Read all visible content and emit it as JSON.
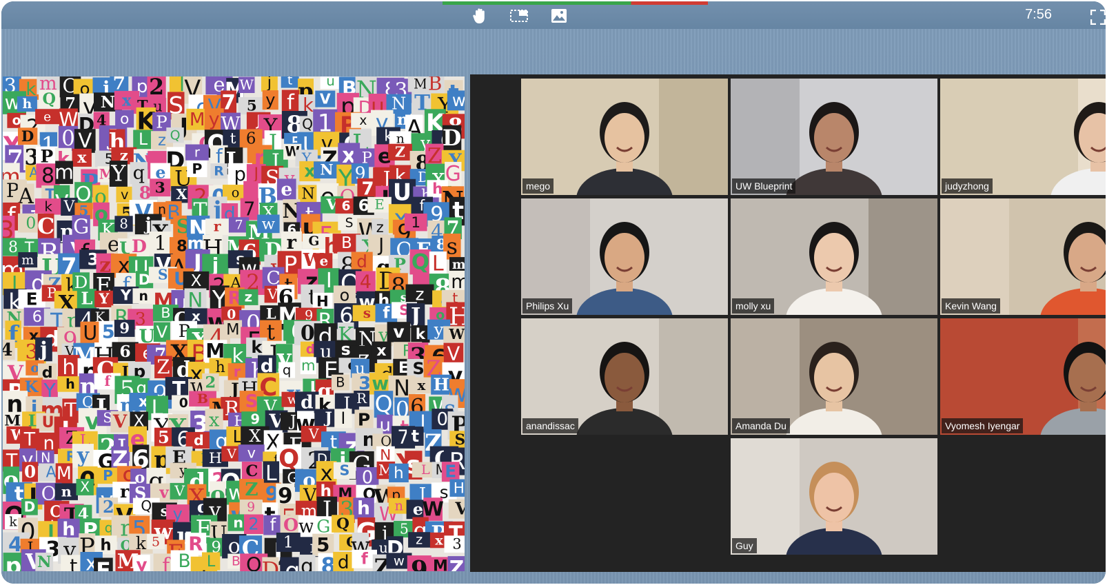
{
  "toolbar": {
    "clock": "7:56",
    "icons": [
      "hand-icon",
      "region-select-icon",
      "image-icon",
      "fullscreen-icon"
    ],
    "progress_green_fraction": 0.71,
    "progress_colors": {
      "done": "#39a54a",
      "remaining": "#d13c33"
    }
  },
  "puzzle": {
    "description_color": "#e9e6e0"
  },
  "meeting": {
    "participants": [
      {
        "name": "mego",
        "speaking": false
      },
      {
        "name": "UW Blueprint",
        "speaking": false
      },
      {
        "name": "judyzhong",
        "speaking": true
      },
      {
        "name": "Philips Xu",
        "speaking": false
      },
      {
        "name": "molly xu",
        "speaking": false
      },
      {
        "name": "Kevin Wang",
        "speaking": false
      },
      {
        "name": "anandissac",
        "speaking": false
      },
      {
        "name": "Amanda Du",
        "speaking": false
      },
      {
        "name": "Vyomesh Iyengar",
        "speaking": false
      },
      {
        "name": "Guy",
        "speaking": false
      }
    ]
  }
}
